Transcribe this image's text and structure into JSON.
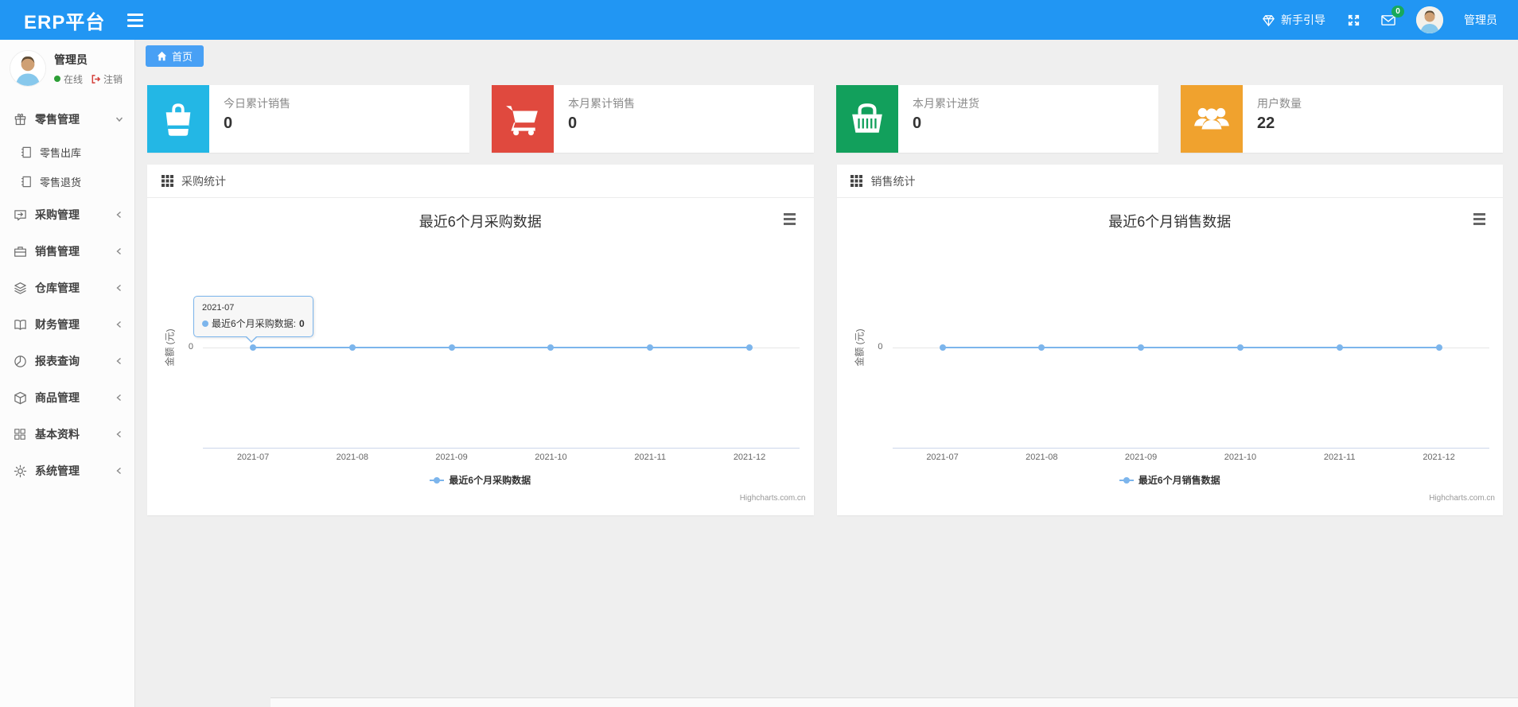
{
  "navbar": {
    "brand": "ERP平台",
    "guide_label": "新手引导",
    "mail_badge": "0",
    "user_label": "管理员"
  },
  "sidebar": {
    "profile": {
      "name": "管理员",
      "status": "在线",
      "logout": "注销"
    },
    "menu": [
      {
        "label": "零售管理",
        "icon": "gift-icon",
        "expanded": true,
        "children": [
          {
            "label": "零售出库",
            "icon": "notebook-icon"
          },
          {
            "label": "零售退货",
            "icon": "notebook-icon"
          }
        ]
      },
      {
        "label": "采购管理",
        "icon": "chat-repeat-icon"
      },
      {
        "label": "销售管理",
        "icon": "briefcase-icon"
      },
      {
        "label": "仓库管理",
        "icon": "layers-icon"
      },
      {
        "label": "财务管理",
        "icon": "open-book-icon"
      },
      {
        "label": "报表查询",
        "icon": "pie-chart-icon"
      },
      {
        "label": "商品管理",
        "icon": "cube-icon"
      },
      {
        "label": "基本资料",
        "icon": "grid-icon"
      },
      {
        "label": "系统管理",
        "icon": "gear-icon"
      }
    ]
  },
  "tabs": [
    {
      "label": "首页",
      "active": true
    }
  ],
  "stat_cards": [
    {
      "label": "今日累计销售",
      "value": "0",
      "icon": "shopping-bag-icon",
      "color": "#23b7e5"
    },
    {
      "label": "本月累计销售",
      "value": "0",
      "icon": "shopping-cart-icon",
      "color": "#e0493e"
    },
    {
      "label": "本月累计进货",
      "value": "0",
      "icon": "shopping-basket-icon",
      "color": "#12a05c"
    },
    {
      "label": "用户数量",
      "value": "22",
      "icon": "users-icon",
      "color": "#f0a22e"
    }
  ],
  "chart_data": [
    {
      "type": "line",
      "panel_title": "采购统计",
      "title": "最近6个月采购数据",
      "categories": [
        "2021-07",
        "2021-08",
        "2021-09",
        "2021-10",
        "2021-11",
        "2021-12"
      ],
      "series": [
        {
          "name": "最近6个月采购数据",
          "values": [
            0,
            0,
            0,
            0,
            0,
            0
          ],
          "color": "#7cb5ec"
        }
      ],
      "ylabel": "金额 (元)",
      "yticks": [
        "0"
      ],
      "ylim": [
        -1,
        1
      ],
      "grid": true,
      "legend_position": "bottom",
      "credits": "Highcharts.com.cn",
      "tooltip": {
        "visible": true,
        "header": "2021-07",
        "series_name": "最近6个月采购数据",
        "value": "0"
      }
    },
    {
      "type": "line",
      "panel_title": "销售统计",
      "title": "最近6个月销售数据",
      "categories": [
        "2021-07",
        "2021-08",
        "2021-09",
        "2021-10",
        "2021-11",
        "2021-12"
      ],
      "series": [
        {
          "name": "最近6个月销售数据",
          "values": [
            0,
            0,
            0,
            0,
            0,
            0
          ],
          "color": "#7cb5ec"
        }
      ],
      "ylabel": "金额 (元)",
      "yticks": [
        "0"
      ],
      "ylim": [
        -1,
        1
      ],
      "grid": true,
      "legend_position": "bottom",
      "credits": "Highcharts.com.cn",
      "tooltip": {
        "visible": false
      }
    }
  ],
  "colors": {
    "navbar_bg": "#2196f3",
    "tab_bg": "#48a0f5",
    "badge_bg": "#18a95c",
    "online_dot": "#2d9e36",
    "logout_red": "#d43f3a",
    "series_line": "#7cb5ec",
    "zero_gridline": "#e6e6e6",
    "axis_line": "#ccd6eb"
  }
}
